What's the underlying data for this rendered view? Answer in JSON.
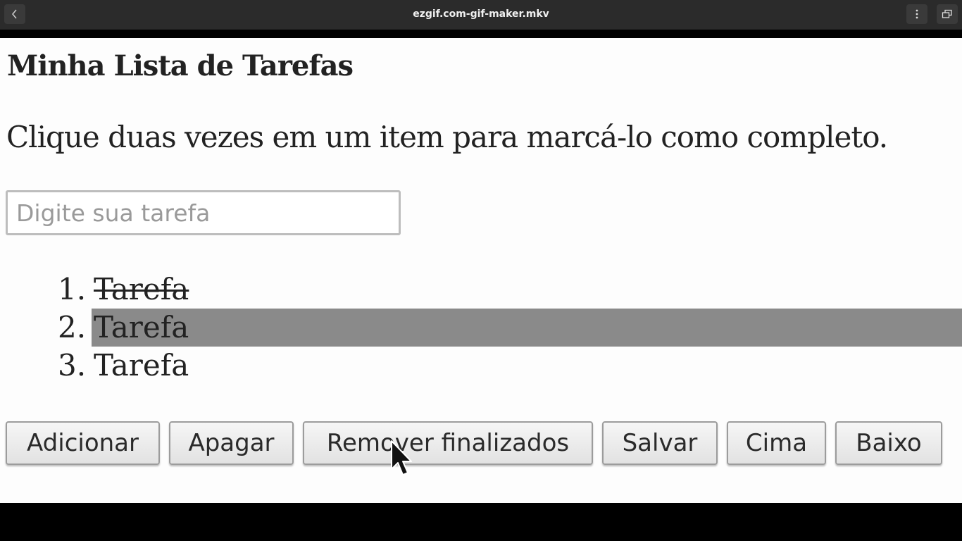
{
  "window": {
    "title": "ezgif.com-gif-maker.mkv"
  },
  "page": {
    "title": "Minha Lista de Tarefas",
    "instruction": "Clique duas vezes em um item para marcá-lo como completo.",
    "task_input": {
      "value": "",
      "placeholder": "Digite sua tarefa"
    },
    "tasks": [
      {
        "number": "1.",
        "text": "Tarefa",
        "completed": true,
        "selected": false
      },
      {
        "number": "2.",
        "text": "Tarefa",
        "completed": false,
        "selected": true
      },
      {
        "number": "3.",
        "text": "Tarefa",
        "completed": false,
        "selected": false
      }
    ],
    "buttons": {
      "add": "Adicionar",
      "delete": "Apagar",
      "remove_completed": "Remover finalizados",
      "save": "Salvar",
      "up": "Cima",
      "down": "Baixo"
    }
  },
  "icons": {
    "back": "chevron-left-icon",
    "menu": "vertical-dots-icon",
    "restore": "restore-window-icon",
    "cursor": "mouse-pointer-icon"
  },
  "colors": {
    "topbar": "#2b2b2b",
    "page_background": "#fdfdfd",
    "selected_row": "#8a8a8a"
  }
}
